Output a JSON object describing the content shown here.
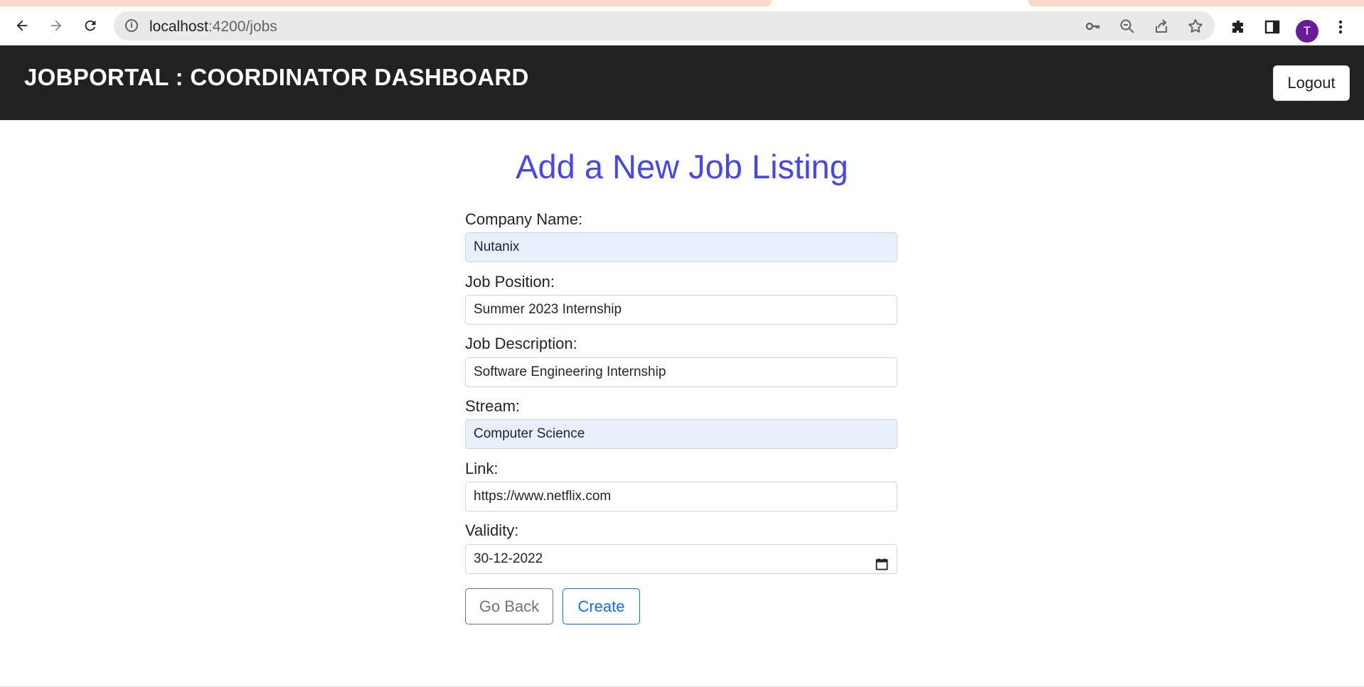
{
  "browser": {
    "url_host": "localhost",
    "url_path": ":4200/jobs",
    "avatar_letter": "T",
    "accent": "#6a1b9a"
  },
  "header": {
    "title": "JOBPORTAL : COORDINATOR DASHBOARD",
    "logout_label": "Logout"
  },
  "form": {
    "title": "Add a New Job Listing",
    "fields": [
      {
        "label": "Company Name:",
        "value": "Nutanix"
      },
      {
        "label": "Job Position:",
        "value": "Summer 2023 Internship"
      },
      {
        "label": "Job Description:",
        "value": "Software Engineering Internship"
      },
      {
        "label": "Stream:",
        "value": "Computer Science"
      },
      {
        "label": "Link:",
        "value": "https://www.netflix.com"
      },
      {
        "label": "Validity:",
        "value": "30-12-2022"
      }
    ],
    "back_label": "Go Back",
    "create_label": "Create"
  },
  "colors": {
    "header_bg": "#212121",
    "title_color": "#4747e6",
    "autofill_bg": "#e8f0fe",
    "primary": "#0d6efd",
    "secondary": "#6c757d"
  },
  "icons": [
    "back-icon",
    "forward-icon",
    "reload-icon",
    "info-icon",
    "key-icon",
    "zoom-out-icon",
    "share-icon",
    "star-icon",
    "extensions-icon",
    "side-panel-icon",
    "menu-icon",
    "calendar-icon"
  ]
}
